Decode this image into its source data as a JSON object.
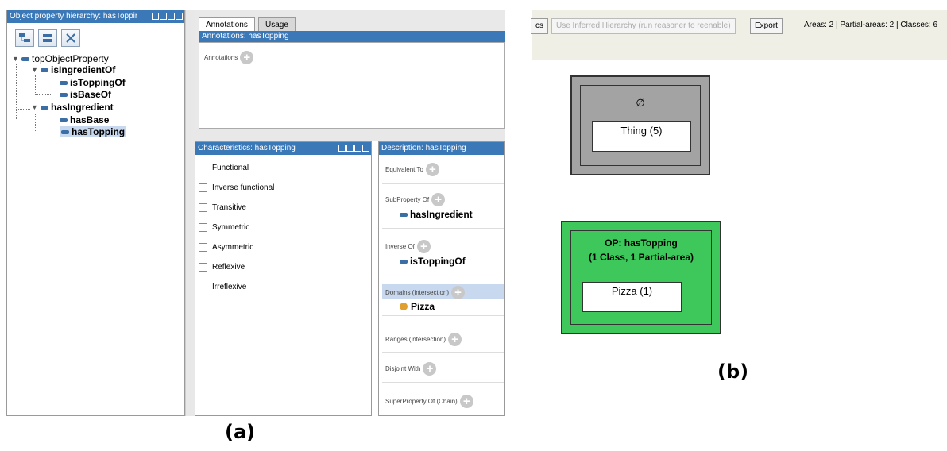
{
  "panel_a": {
    "hierarchy": {
      "title": "Object property hierarchy: hasToppir",
      "nodes": [
        {
          "label": "topObjectProperty"
        },
        {
          "label": "isIngredientOf"
        },
        {
          "label": "isToppingOf"
        },
        {
          "label": "isBaseOf"
        },
        {
          "label": "hasIngredient"
        },
        {
          "label": "hasBase"
        },
        {
          "label": "hasTopping"
        }
      ]
    },
    "annotations": {
      "tabs": [
        "Annotations",
        "Usage"
      ],
      "header": "Annotations: hasTopping",
      "add_label": "Annotations"
    },
    "characteristics": {
      "header": "Characteristics: hasTopping",
      "items": [
        "Functional",
        "Inverse functional",
        "Transitive",
        "Symmetric",
        "Asymmetric",
        "Reflexive",
        "Irreflexive"
      ]
    },
    "description": {
      "header": "Description: hasTopping",
      "equivalent_to": "Equivalent To",
      "subproperty_of": "SubProperty Of",
      "subproperty_value": "hasIngredient",
      "inverse_of": "Inverse Of",
      "inverse_value": "isToppingOf",
      "domains": "Domains (intersection)",
      "domains_value": "Pizza",
      "ranges": "Ranges (intersection)",
      "disjoint_with": "Disjoint With",
      "superproperty_chain": "SuperProperty Of (Chain)"
    },
    "figure_label": "(a)"
  },
  "panel_b": {
    "toolbar": {
      "cut_button": "cs",
      "inferred_button": "Use Inferred Hierarchy (run reasoner to reenable)",
      "export_button": "Export",
      "stats": "Areas: 2 | Partial-areas: 2 | Classes: 6"
    },
    "root_area": {
      "symbol": "∅",
      "class_label": "Thing (5)"
    },
    "op_area": {
      "title": "OP: hasTopping",
      "subtitle": "(1 Class, 1 Partial-area)",
      "class_label": "Pizza (1)"
    },
    "figure_label": "(b)"
  },
  "colors": {
    "protege_blue": "#3b78b8",
    "root_area_gray": "#a3a3a3",
    "op_area_green": "#3ec75a"
  }
}
